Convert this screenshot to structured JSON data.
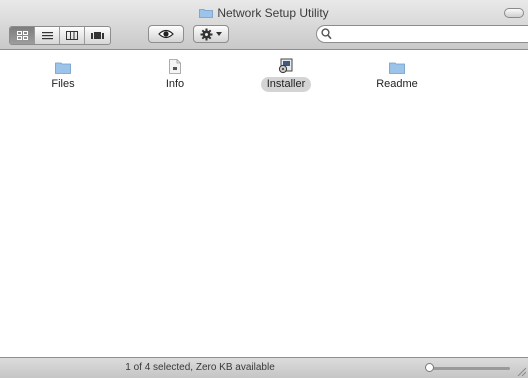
{
  "window": {
    "title": "Network Setup Utility"
  },
  "toolbar": {
    "view_modes": [
      {
        "name": "icon-view",
        "icon": "grid-icon",
        "active": true
      },
      {
        "name": "list-view",
        "icon": "list-icon",
        "active": false
      },
      {
        "name": "column-view",
        "icon": "columns-icon",
        "active": false
      },
      {
        "name": "coverflow-view",
        "icon": "coverflow-icon",
        "active": false
      }
    ],
    "quick_look_icon": "eye-icon",
    "action_icon": "gear-icon",
    "search": {
      "value": "",
      "placeholder": ""
    }
  },
  "files": [
    {
      "name": "Files",
      "icon": "folder-icon",
      "selected": false
    },
    {
      "name": "Info",
      "icon": "document-icon",
      "selected": false
    },
    {
      "name": "Installer",
      "icon": "installer-icon",
      "selected": true
    },
    {
      "name": "Readme",
      "icon": "folder-icon",
      "selected": false
    }
  ],
  "status": {
    "text": "1 of 4 selected, Zero KB available",
    "icon_size_level": 0.0
  },
  "colors": {
    "folder": "#9cc4ea",
    "selection": "#d4d4d4"
  }
}
